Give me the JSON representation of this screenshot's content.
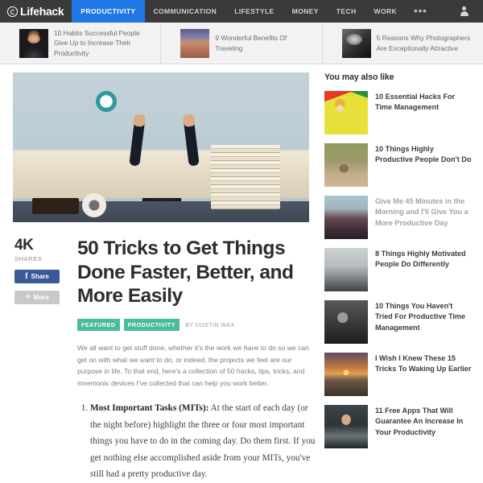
{
  "nav": {
    "brand": "Lifehack",
    "brand_icon": "lifehack-logo-icon",
    "items": [
      {
        "label": "PRODUCTIVITY",
        "active": true
      },
      {
        "label": "COMMUNICATION",
        "active": false
      },
      {
        "label": "LIFESTYLE",
        "active": false
      },
      {
        "label": "MONEY",
        "active": false
      },
      {
        "label": "TECH",
        "active": false
      },
      {
        "label": "WORK",
        "active": false
      }
    ],
    "more_label": "•••",
    "account_icon": "user-icon",
    "active_color": "#1e77e4",
    "bar_color": "#3a3a3a"
  },
  "substrip": {
    "cards": [
      {
        "title": "10 Habits Successful People Give Up to Increase Their Productivity",
        "thumb": "t1"
      },
      {
        "title": "9 Wonderful Benefits Of Traveling",
        "thumb": "t2"
      },
      {
        "title": "5 Reasons Why Photographers Are Exceptionally Attractive",
        "thumb": "t3"
      }
    ]
  },
  "article": {
    "hero_alt": "boy-cheering-at-desk-with-clock-image",
    "shares_count": "4K",
    "shares_label": "SHARES",
    "share_button": "Share",
    "more_button": "More",
    "share_color": "#3b5998",
    "headline": "50 Tricks to Get Things Done Faster, Better, and More Easily",
    "tags": [
      "FEATURED",
      "PRODUCTIVITY"
    ],
    "tag_color": "#49bd9b",
    "byline": "BY DUSTIN WAX",
    "lede_1": "We all want to get stuff done, whether it's the work we ",
    "lede_em_1": "have",
    "lede_2": " to do so we can get on with what we ",
    "lede_em_2": "want",
    "lede_3": " to do, or indeed, the projects we feel are our purpose in life. To that end, here's a collection of 50 hacks, tips, tricks, and mnemonic devices I've collected that can help you work better.",
    "list_items": [
      {
        "lead": "Most Important Tasks (MITs):",
        "body": " At the start of each day (or the night before) highlight the three or four most important things you have to do in the coming day.  Do them first.  If you get nothing else accomplished aside from your MITs, you've still had a pretty productive day."
      }
    ]
  },
  "sidebar": {
    "title": "You may also like",
    "items": [
      {
        "label": "10 Essential Hacks For Time Management",
        "thumb": "sb1",
        "dim": false
      },
      {
        "label": "10 Things Highly Productive People Don't Do",
        "thumb": "sb2",
        "dim": false
      },
      {
        "label": "Give Me 45 Minutes in the Morning and I'll Give You a More Productive Day",
        "thumb": "sb3",
        "dim": true
      },
      {
        "label": "8 Things Highly Motivated People Do Differently",
        "thumb": "sb4",
        "dim": false
      },
      {
        "label": "10 Things You Haven't Tried For Productive Time Management",
        "thumb": "sb5",
        "dim": false
      },
      {
        "label": "I Wish I Knew These 15 Tricks To Waking Up Earlier",
        "thumb": "sb6",
        "dim": false
      },
      {
        "label": "11 Free Apps That Will Guarantee An Increase In Your Productivity",
        "thumb": "sb7",
        "dim": false
      }
    ]
  }
}
